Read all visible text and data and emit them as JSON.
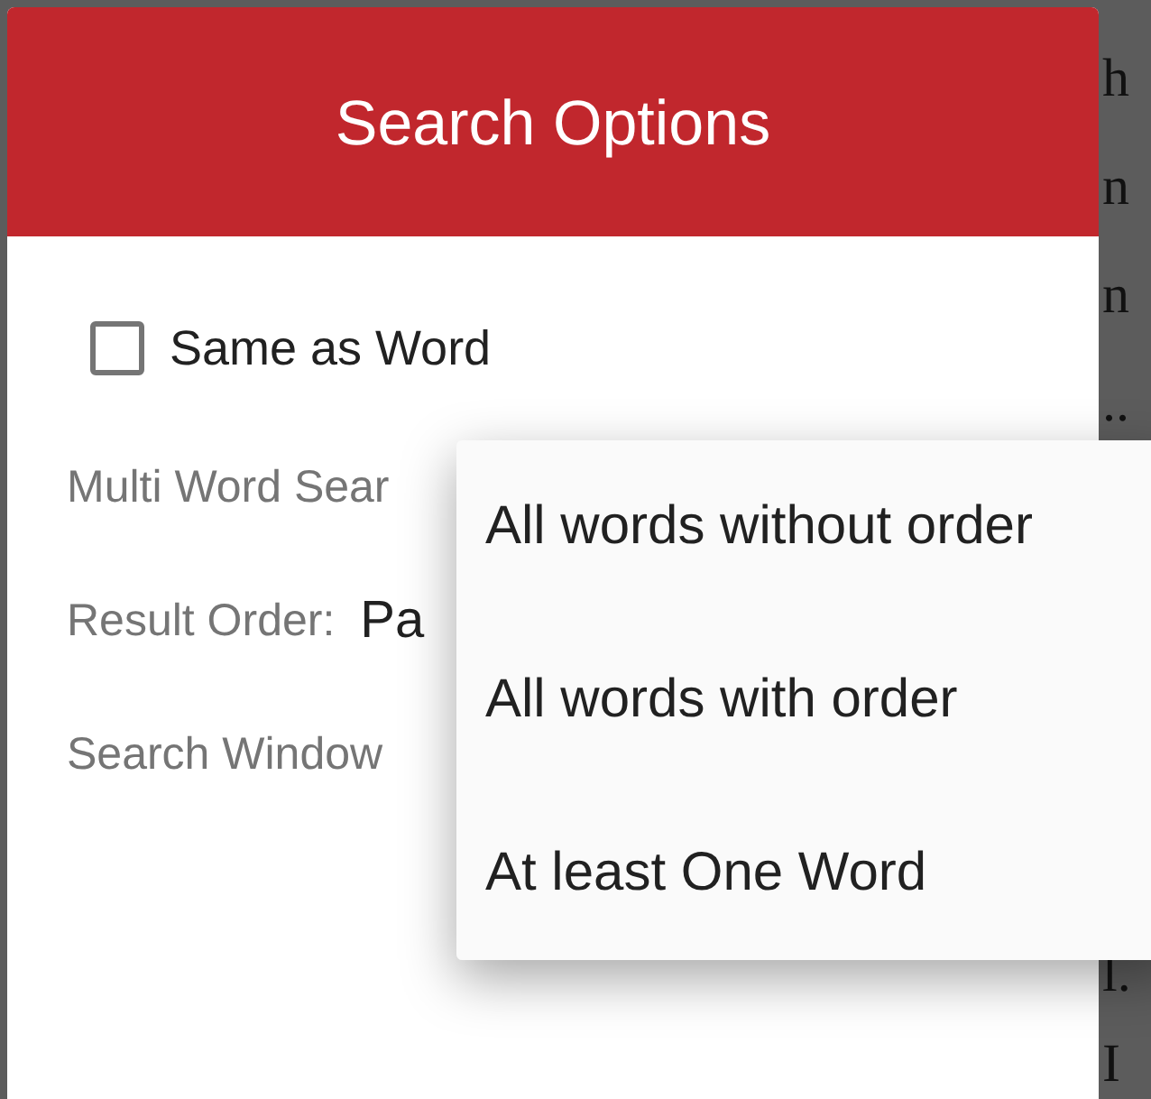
{
  "dialog": {
    "title": "Search Options",
    "same_as_word": {
      "label": "Same as Word",
      "checked": false
    },
    "fields": [
      {
        "label": "Multi Word Sear"
      },
      {
        "label": "Result Order:",
        "value": "Pa"
      },
      {
        "label": "Search Window"
      }
    ]
  },
  "menu": {
    "items": [
      {
        "label": "All words without order"
      },
      {
        "label": "All words with order"
      },
      {
        "label": "At least One Word"
      }
    ]
  },
  "background_text": {
    "top": [
      "h",
      "n",
      "n",
      ".."
    ],
    "bottom": [
      "l.",
      "I"
    ]
  }
}
